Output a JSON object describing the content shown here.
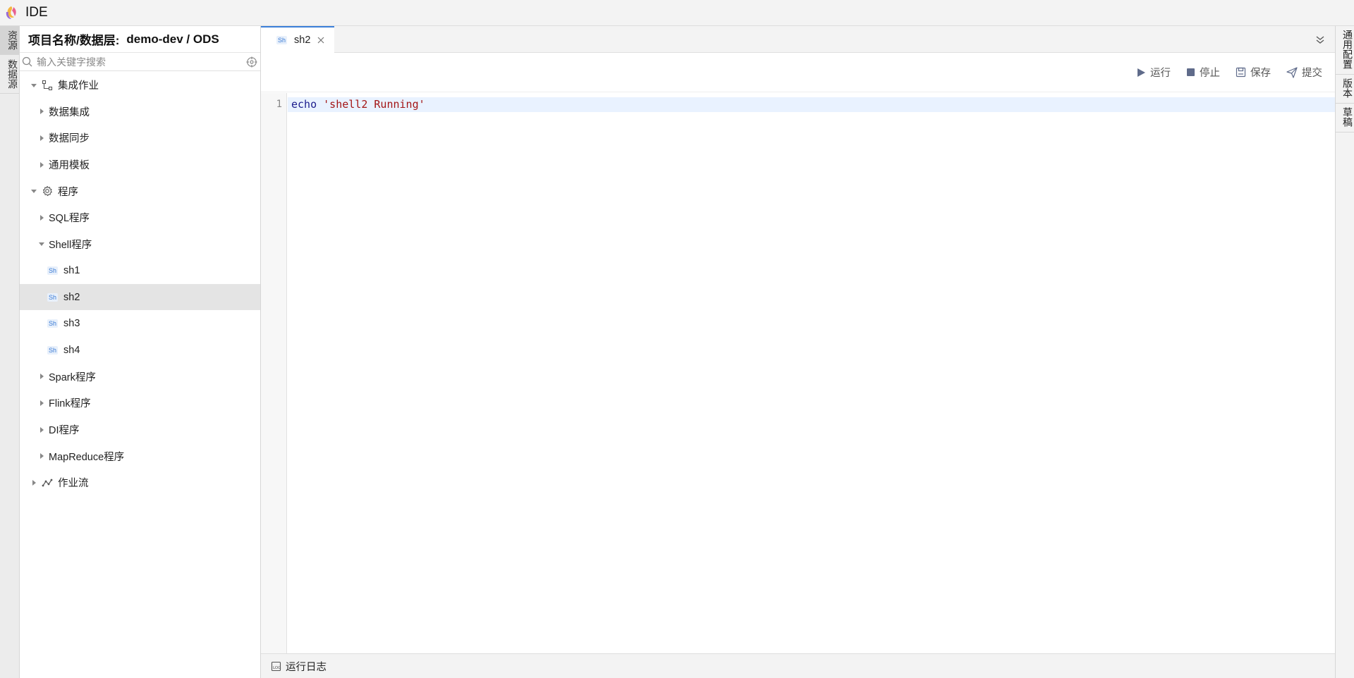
{
  "app": {
    "title": "IDE"
  },
  "left_tabs": [
    "资源",
    "数据源"
  ],
  "explorer": {
    "header_label": "项目名称/数据层:",
    "project_path": "demo-dev / ODS",
    "search_placeholder": "输入关键字搜索",
    "tree": [
      {
        "label": "集成作业",
        "level": 0,
        "expanded": true,
        "icon": "integration-icon"
      },
      {
        "label": "数据集成",
        "level": 1,
        "expanded": false
      },
      {
        "label": "数据同步",
        "level": 1,
        "expanded": false
      },
      {
        "label": "通用模板",
        "level": 1,
        "expanded": false
      },
      {
        "label": "程序",
        "level": 0,
        "expanded": true,
        "icon": "gear-icon"
      },
      {
        "label": "SQL程序",
        "level": 1,
        "expanded": false
      },
      {
        "label": "Shell程序",
        "level": 1,
        "expanded": true
      },
      {
        "label": "sh1",
        "level": 2,
        "badge": "Sh"
      },
      {
        "label": "sh2",
        "level": 2,
        "badge": "Sh",
        "selected": true
      },
      {
        "label": "sh3",
        "level": 2,
        "badge": "Sh"
      },
      {
        "label": "sh4",
        "level": 2,
        "badge": "Sh"
      },
      {
        "label": "Spark程序",
        "level": 1,
        "expanded": false
      },
      {
        "label": "Flink程序",
        "level": 1,
        "expanded": false
      },
      {
        "label": "DI程序",
        "level": 1,
        "expanded": false
      },
      {
        "label": "MapReduce程序",
        "level": 1,
        "expanded": false
      },
      {
        "label": "作业流",
        "level": 0,
        "expanded": false,
        "icon": "workflow-icon"
      }
    ]
  },
  "tabs": [
    {
      "badge": "Sh",
      "label": "sh2",
      "active": true
    }
  ],
  "toolbar": {
    "run": "运行",
    "stop": "停止",
    "save": "保存",
    "submit": "提交"
  },
  "editor": {
    "line_number": "1",
    "code_keyword": "echo",
    "code_string": "'shell2 Running'"
  },
  "log_bar": {
    "label": "运行日志"
  },
  "right_tabs": [
    "通用配置",
    "版本",
    "草稿"
  ],
  "colors": {
    "accent": "#3b7fd9",
    "selected_row": "#e4e4e4",
    "active_line": "#e9f2ff"
  }
}
